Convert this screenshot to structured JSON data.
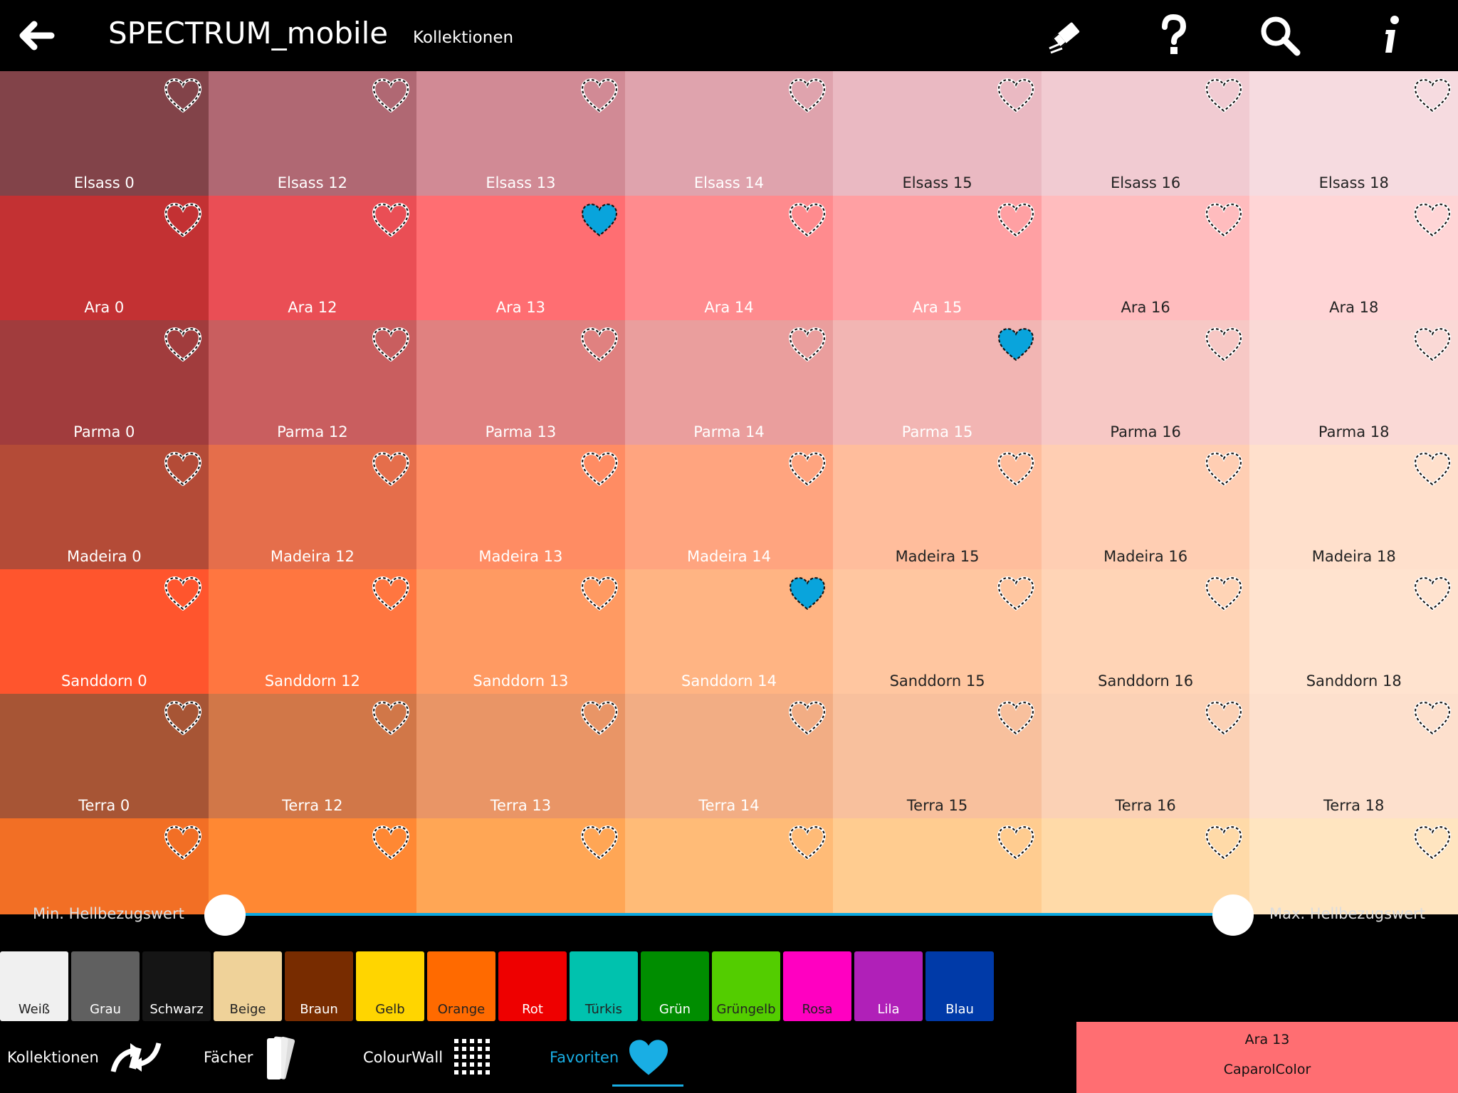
{
  "header": {
    "title": "SPECTRUM_mobile",
    "collections_link": "Kollektionen"
  },
  "colors": {
    "accent": "#19aee4",
    "heart_filled": "#09a4dc"
  },
  "grid": {
    "rows": [
      {
        "cells": [
          {
            "label": "Elsass 0",
            "color": "#824349",
            "fav": false
          },
          {
            "label": "Elsass 12",
            "color": "#b06873",
            "fav": false
          },
          {
            "label": "Elsass 13",
            "color": "#d18a95",
            "fav": false
          },
          {
            "label": "Elsass 14",
            "color": "#dfa3ad",
            "fav": false
          },
          {
            "label": "Elsass 15",
            "color": "#eab9c2",
            "fav": false
          },
          {
            "label": "Elsass 16",
            "color": "#f1cbd2",
            "fav": false
          },
          {
            "label": "Elsass 18",
            "color": "#f6dbe0",
            "fav": false
          }
        ]
      },
      {
        "cells": [
          {
            "label": "Ara 0",
            "color": "#c33133",
            "fav": false
          },
          {
            "label": "Ara 12",
            "color": "#ea4e55",
            "fav": false
          },
          {
            "label": "Ara 13",
            "color": "#ff6e72",
            "fav": true
          },
          {
            "label": "Ara 14",
            "color": "#ff8b8e",
            "fav": false
          },
          {
            "label": "Ara 15",
            "color": "#ffa0a3",
            "fav": false
          },
          {
            "label": "Ara 16",
            "color": "#ffbcbe",
            "fav": false
          },
          {
            "label": "Ara 18",
            "color": "#ffd5d6",
            "fav": false
          }
        ]
      },
      {
        "cells": [
          {
            "label": "Parma 0",
            "color": "#a13c3d",
            "fav": false
          },
          {
            "label": "Parma 12",
            "color": "#c95e5f",
            "fav": false
          },
          {
            "label": "Parma 13",
            "color": "#e08180",
            "fav": false
          },
          {
            "label": "Parma 14",
            "color": "#ea9e9d",
            "fav": false
          },
          {
            "label": "Parma 15",
            "color": "#f2b5b3",
            "fav": true
          },
          {
            "label": "Parma 16",
            "color": "#f7c8c5",
            "fav": false
          },
          {
            "label": "Parma 18",
            "color": "#fad9d6",
            "fav": false
          }
        ]
      },
      {
        "cells": [
          {
            "label": "Madeira 0",
            "color": "#b44b37",
            "fav": false
          },
          {
            "label": "Madeira 12",
            "color": "#e56e4b",
            "fav": false
          },
          {
            "label": "Madeira 13",
            "color": "#ff8c63",
            "fav": false
          },
          {
            "label": "Madeira 14",
            "color": "#ffa47f",
            "fav": false
          },
          {
            "label": "Madeira 15",
            "color": "#ffbd9c",
            "fav": false
          },
          {
            "label": "Madeira 16",
            "color": "#ffceb3",
            "fav": false
          },
          {
            "label": "Madeira 18",
            "color": "#ffe0cc",
            "fav": false
          }
        ]
      },
      {
        "cells": [
          {
            "label": "Sanddorn 0",
            "color": "#ff552d",
            "fav": false
          },
          {
            "label": "Sanddorn 12",
            "color": "#ff7640",
            "fav": false
          },
          {
            "label": "Sanddorn 13",
            "color": "#ff9a62",
            "fav": false
          },
          {
            "label": "Sanddorn 14",
            "color": "#ffb483",
            "fav": true
          },
          {
            "label": "Sanddorn 15",
            "color": "#ffc6a0",
            "fav": false
          },
          {
            "label": "Sanddorn 16",
            "color": "#ffd4b6",
            "fav": false
          },
          {
            "label": "Sanddorn 18",
            "color": "#ffe3cf",
            "fav": false
          }
        ]
      },
      {
        "cells": [
          {
            "label": "Terra 0",
            "color": "#a75535",
            "fav": false
          },
          {
            "label": "Terra 12",
            "color": "#d17748",
            "fav": false
          },
          {
            "label": "Terra 13",
            "color": "#e99566",
            "fav": false
          },
          {
            "label": "Terra 14",
            "color": "#f2ad84",
            "fav": false
          },
          {
            "label": "Terra 15",
            "color": "#f8c09d",
            "fav": false
          },
          {
            "label": "Terra 16",
            "color": "#fbd1b5",
            "fav": false
          },
          {
            "label": "Terra 18",
            "color": "#fde0cd",
            "fav": false
          }
        ]
      },
      {
        "cells": [
          {
            "label": "",
            "color": "#f26f25",
            "fav": false
          },
          {
            "label": "",
            "color": "#ff8833",
            "fav": false
          },
          {
            "label": "",
            "color": "#ffa655",
            "fav": false
          },
          {
            "label": "",
            "color": "#ffbb77",
            "fav": false
          },
          {
            "label": "",
            "color": "#ffcc90",
            "fav": false
          },
          {
            "label": "",
            "color": "#ffdaa8",
            "fav": false
          },
          {
            "label": "",
            "color": "#ffe5c0",
            "fav": false
          }
        ]
      }
    ]
  },
  "slider": {
    "min_label": "Min. Hellbezugswert",
    "max_label": "Max. Hellbezugswert",
    "min_value": 0,
    "max_value": 1
  },
  "families": [
    {
      "label": "Weiß",
      "color": "#f0f0f0",
      "text": "#222"
    },
    {
      "label": "Grau",
      "color": "#606060",
      "text": "#fff"
    },
    {
      "label": "Schwarz",
      "color": "#151515",
      "text": "#fff"
    },
    {
      "label": "Beige",
      "color": "#efd299",
      "text": "#222"
    },
    {
      "label": "Braun",
      "color": "#782c00",
      "text": "#fff"
    },
    {
      "label": "Gelb",
      "color": "#ffd500",
      "text": "#222"
    },
    {
      "label": "Orange",
      "color": "#ff6a00",
      "text": "#222"
    },
    {
      "label": "Rot",
      "color": "#ee0000",
      "text": "#fff"
    },
    {
      "label": "Türkis",
      "color": "#00c2ae",
      "text": "#222"
    },
    {
      "label": "Grün",
      "color": "#008d00",
      "text": "#fff"
    },
    {
      "label": "Grüngelb",
      "color": "#53cd00",
      "text": "#222"
    },
    {
      "label": "Rosa",
      "color": "#ff00c1",
      "text": "#222"
    },
    {
      "label": "Lila",
      "color": "#b020b8",
      "text": "#fff"
    },
    {
      "label": "Blau",
      "color": "#003aa8",
      "text": "#fff"
    }
  ],
  "nav": {
    "kollektionen": "Kollektionen",
    "faecher": "Fächer",
    "colourwall": "ColourWall",
    "favoriten": "Favoriten"
  },
  "selected": {
    "name": "Ara 13",
    "brand": "CaparolColor",
    "color": "#ff6e72"
  }
}
